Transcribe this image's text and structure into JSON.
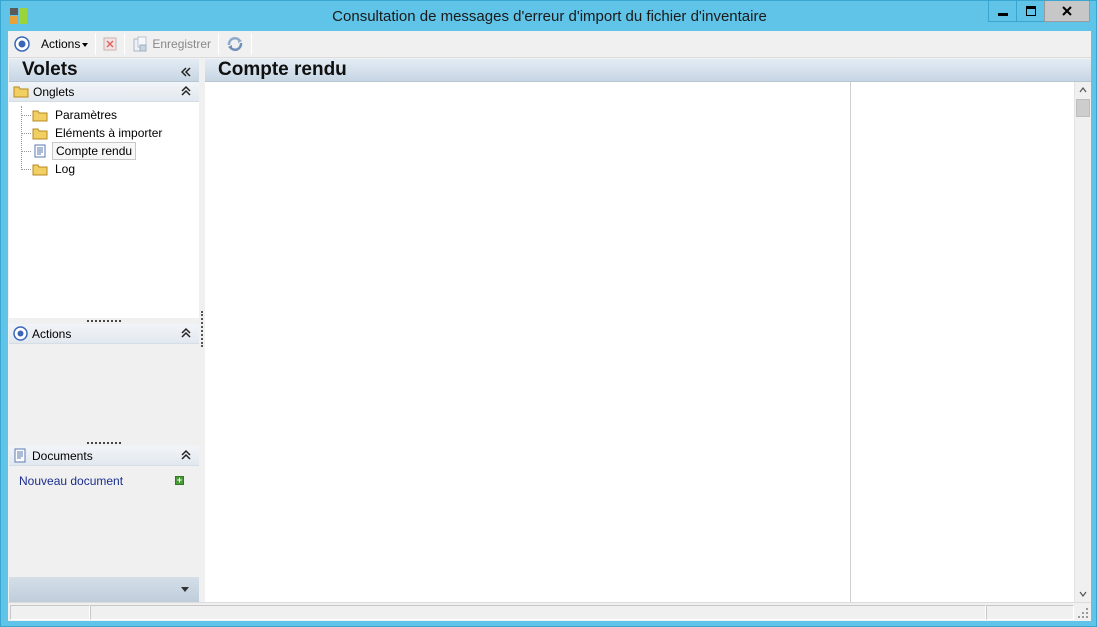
{
  "window": {
    "title": "Consultation de messages d'erreur d'import du fichier d'inventaire",
    "icon": "app-icon"
  },
  "toolbar": {
    "actions_label": "Actions",
    "delete_icon": "delete-icon",
    "save_label": "Enregistrer",
    "refresh_icon": "refresh-icon"
  },
  "left_pane": {
    "title": "Volets",
    "onglets": {
      "label": "Onglets",
      "items": [
        {
          "label": "Paramètres",
          "icon": "folder-icon"
        },
        {
          "label": "Eléments à importer",
          "icon": "folder-icon"
        },
        {
          "label": "Compte rendu",
          "icon": "document-icon",
          "selected": true
        },
        {
          "label": "Log",
          "icon": "folder-icon"
        }
      ]
    },
    "actions": {
      "label": "Actions"
    },
    "documents": {
      "label": "Documents",
      "new_document": "Nouveau document"
    }
  },
  "main": {
    "title": "Compte rendu"
  },
  "statusbar": {
    "cells": [
      "",
      "",
      ""
    ]
  },
  "colors": {
    "window_frame": "#60c4e8",
    "header_gradient_top": "#e3ecf4",
    "header_gradient_bottom": "#c7d6e4",
    "link": "#1a2e8c"
  }
}
